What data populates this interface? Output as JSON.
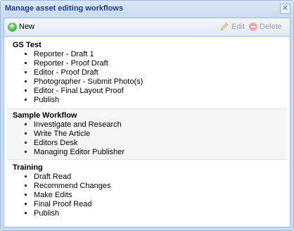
{
  "window": {
    "title": "Manage asset editing workflows",
    "close_symbol": "✕"
  },
  "toolbar": {
    "new_label": "New",
    "edit_label": "Edit",
    "delete_label": "Delete"
  },
  "groups": [
    {
      "title": "GS Test",
      "steps": [
        "Reporter - Draft 1",
        "Reporter - Proof Draft",
        "Editor - Proof Draft",
        "Photographer - Submit Photo(s)",
        "Editor - Final Layout Proof",
        "Publish"
      ]
    },
    {
      "title": "Sample Workflow",
      "steps": [
        "Investigate and Research",
        "Write The Article",
        "Editors Desk",
        "Managing Editor Publisher"
      ]
    },
    {
      "title": "Training",
      "steps": [
        "Draft Read",
        "Recommend Changes",
        "Make Edits",
        "Final Proof Read",
        "Publish"
      ]
    }
  ]
}
